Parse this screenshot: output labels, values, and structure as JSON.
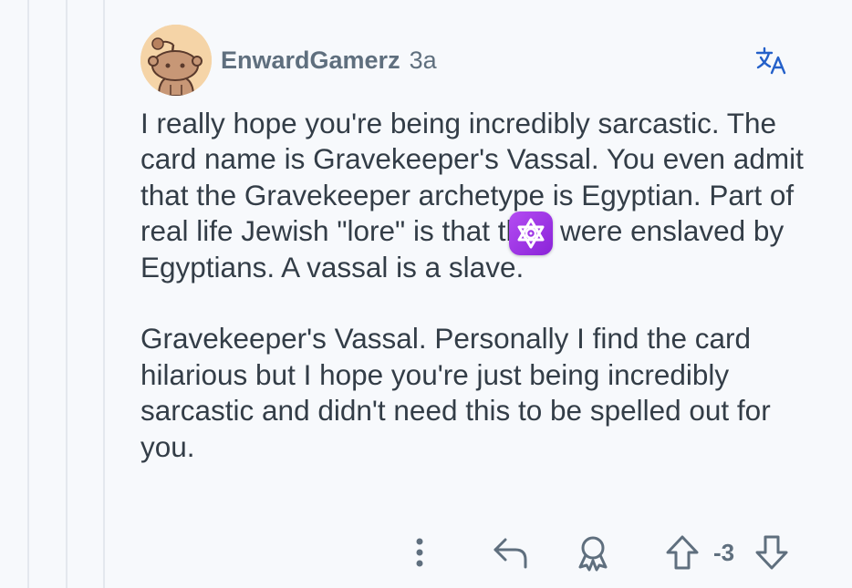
{
  "comment": {
    "author": "EnwardGamerz",
    "age": "3a",
    "paragraphs": [
      "I really hope you're being incredibly sarcastic. The card name is Gravekeeper's Vassal. You even admit that the Gravekeeper archetype is Egyptian. Part of real life Jewish \"lore\" is that they were enslaved by Egyptians. A vassal is a slave.",
      "Gravekeeper's Vassal. Personally I find the card hilarious but I hope you're just being incredibly sarcastic and didn't need this to be spelled out for you."
    ],
    "score": "-3"
  },
  "icons": {
    "avatar": "snoo-avatar",
    "translate": "translate-icon",
    "flair": "star-of-david-badge-icon",
    "more": "more-vertical-icon",
    "reply": "reply-icon",
    "award": "award-icon",
    "upvote": "upvote-arrow-icon",
    "downvote": "downvote-arrow-icon"
  },
  "colors": {
    "background": "#f7f9fc",
    "text": "#333d47",
    "meta": "#5f6f7e",
    "accent_blue": "#2460c9",
    "flair_purple": "#a33be8",
    "avatar_bg": "#f5d4a7"
  }
}
